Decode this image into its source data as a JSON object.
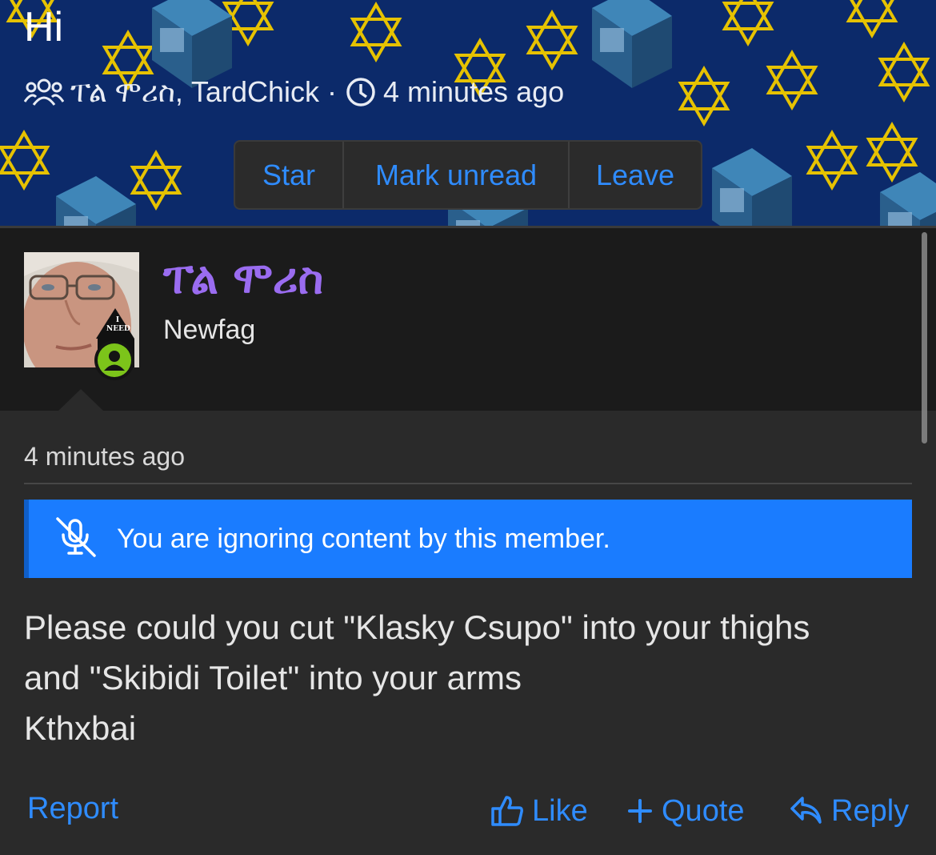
{
  "thread": {
    "title": "Hi",
    "participants": "ፐል ሞሪስ, TardChick",
    "separator": "·",
    "time": "4 minutes ago",
    "actions": {
      "star": "Star",
      "mark_unread": "Mark unread",
      "leave": "Leave"
    }
  },
  "user": {
    "name": "ፐል ሞሪስ",
    "title": "Newfag",
    "avatar_badge": "NEED",
    "avatar_badge_top": "I"
  },
  "message": {
    "time": "4 minutes ago",
    "ignore_notice": "You are ignoring content by this member.",
    "body": [
      "Please could you cut \"Klasky Csupo\" into your thighs",
      "and \"Skibidi Toilet\" into your arms",
      "Kthxbai"
    ]
  },
  "actions": {
    "report": "Report",
    "like": "Like",
    "quote": "Quote",
    "reply": "Reply"
  },
  "colors": {
    "accent": "#2f8cff",
    "banner": "#0c2a6a",
    "username": "#9a6cf0",
    "ignore_bg": "#1a7cff",
    "online": "#7cc41a"
  }
}
